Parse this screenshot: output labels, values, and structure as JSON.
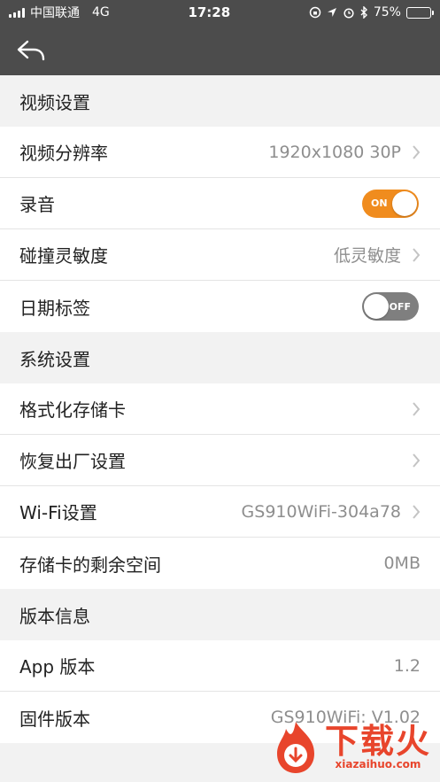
{
  "status_bar": {
    "carrier": "中国联通",
    "network": "4G",
    "time": "17:28",
    "battery": "75%",
    "battery_level": 0.75
  },
  "sections": [
    {
      "title": "视频设置",
      "rows": [
        {
          "label": "视频分辨率",
          "value": "1920x1080 30P",
          "chevron": true
        },
        {
          "label": "录音",
          "toggle": "ON"
        },
        {
          "label": "碰撞灵敏度",
          "value": "低灵敏度",
          "chevron": true
        },
        {
          "label": "日期标签",
          "toggle": "OFF"
        }
      ]
    },
    {
      "title": "系统设置",
      "rows": [
        {
          "label": "格式化存储卡",
          "value": "",
          "chevron": true
        },
        {
          "label": "恢复出厂设置",
          "value": "",
          "chevron": true
        },
        {
          "label": "Wi-Fi设置",
          "value": "GS910WiFi-304a78",
          "chevron": true
        },
        {
          "label": "存储卡的剩余空间",
          "value": "0MB",
          "chevron": false
        }
      ]
    },
    {
      "title": "版本信息",
      "rows": [
        {
          "label": "App 版本",
          "value": "1.2",
          "chevron": false
        },
        {
          "label": "固件版本",
          "value": "GS910WiFi: V1.02",
          "chevron": false
        }
      ]
    }
  ],
  "watermark": {
    "cn": "下载火",
    "en": "xiazaihuo.com"
  },
  "colors": {
    "header": "#4c4c4c",
    "accent": "#f08c1e",
    "toggle_off": "#7f7f7f",
    "watermark": "#e8452c"
  }
}
